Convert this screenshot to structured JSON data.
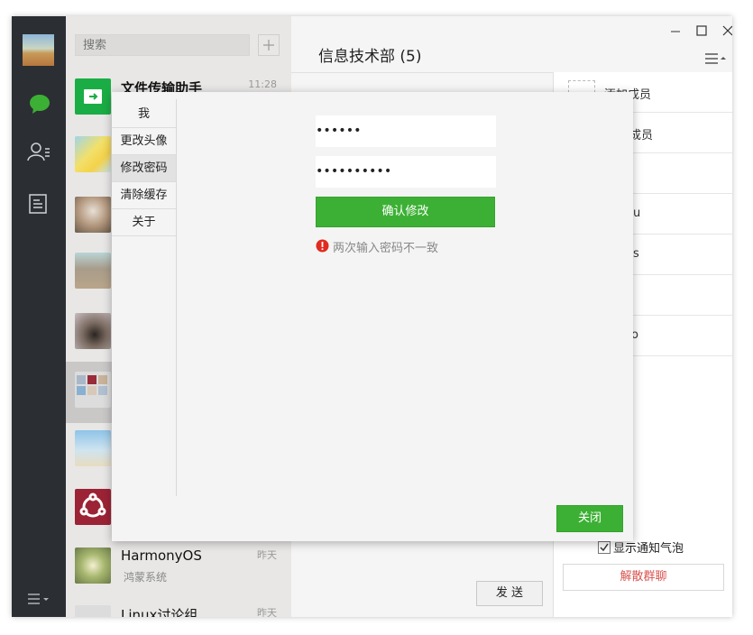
{
  "search": {
    "placeholder": "搜索"
  },
  "chat": {
    "title": "信息技术部 (5)",
    "send_label": "发 送"
  },
  "conversations": [
    {
      "name": "文件传输助手",
      "time": "11:28"
    },
    {
      "name": "",
      "sub": ""
    },
    {
      "name": ""
    },
    {
      "name": ""
    },
    {
      "name": ""
    },
    {
      "name": ""
    },
    {
      "name": ""
    },
    {
      "name": ""
    },
    {
      "name": "HarmonyOS",
      "sub": "鸿蒙系统",
      "time": "昨天"
    },
    {
      "name": "Linux讨论组",
      "time": "昨天"
    }
  ],
  "members": {
    "add_label": "添加成员",
    "rows": [
      "成员",
      "",
      "u",
      "s",
      "",
      "o"
    ],
    "notify_label": "显示通知气泡",
    "notify_checked": true,
    "dissolve_label": "解散群聊"
  },
  "dialog": {
    "menu": [
      "我",
      "更改头像",
      "修改密码",
      "清除缓存",
      "关于"
    ],
    "selected_index": 2,
    "password1": "••••••",
    "password2": "••••••••••",
    "confirm_label": "确认修改",
    "error_text": "两次输入密码不一致",
    "close_label": "关闭"
  },
  "colors": {
    "accent": "#3cb034",
    "rail": "#2b2e33",
    "error": "#e02b20",
    "danger_text": "#d9534f"
  }
}
